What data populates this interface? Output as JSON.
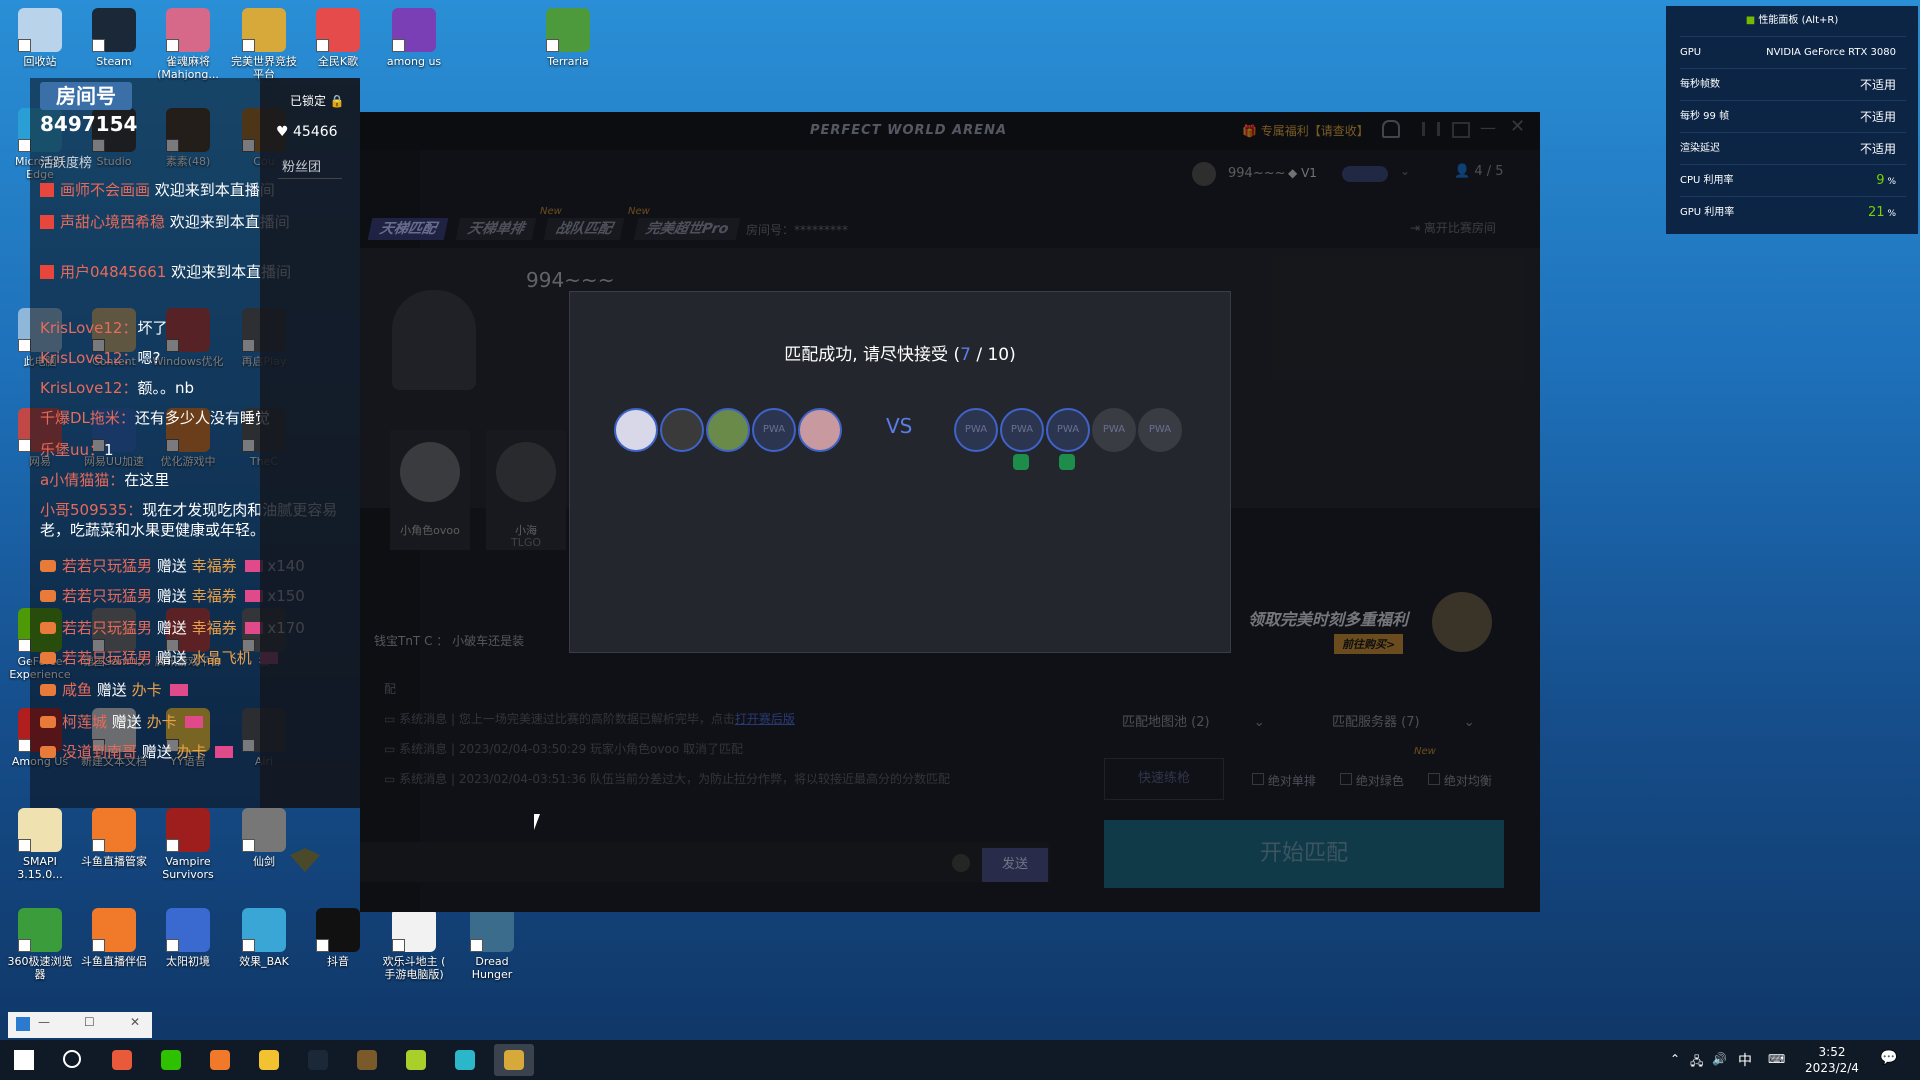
{
  "desktop_icons": [
    {
      "label": "回收站",
      "color": "#b9d3ea"
    },
    {
      "label": "Steam",
      "color": "#1b2838"
    },
    {
      "label": "雀魂麻将(Mahjong...",
      "color": "#d6698a"
    },
    {
      "label": "完美世界竞技平台",
      "color": "#d7a93a"
    },
    {
      "label": "全民K歌",
      "color": "#e64b4b"
    },
    {
      "label": "among us",
      "color": "#7a3fb5"
    },
    {
      "label": "Terraria",
      "color": "#4c9a3c"
    },
    {
      "label": "Microsoft Edge",
      "color": "#2a9fd6"
    },
    {
      "label": "Studio",
      "color": "#323232"
    },
    {
      "label": "素素(48)",
      "color": "#443322"
    },
    {
      "label": "Cou",
      "color": "#a0691e"
    },
    {
      "label": "此电脑",
      "color": "#8fb7da"
    },
    {
      "label": "Content",
      "color": "#c7b07a"
    },
    {
      "label": "Windows优化",
      "color": "#b73c3c"
    },
    {
      "label": "再启Play",
      "color": "#5a5a5a"
    },
    {
      "label": "网易",
      "color": "#c24747"
    },
    {
      "label": "网易UU加速",
      "color": "#2c6cc9"
    },
    {
      "label": "优化游戏中",
      "color": "#e07b27"
    },
    {
      "label": "TheC",
      "color": "#555555"
    },
    {
      "label": "GeForce Experience",
      "color": "#4e9a06"
    },
    {
      "label": "德国Sam\"以",
      "color": "#777777"
    },
    {
      "label": "腾讯游戏平台",
      "color": "#c23b3b"
    },
    {
      "label": "被",
      "color": "#666666"
    },
    {
      "label": "Among Us",
      "color": "#b11e1e"
    },
    {
      "label": "新建文本文档",
      "color": "#e0e0e0"
    },
    {
      "label": "YY语音",
      "color": "#ffd03a"
    },
    {
      "label": "Airi",
      "color": "#555555"
    },
    {
      "label": "SMAPI 3.15.0...",
      "color": "#f0e2b0"
    },
    {
      "label": "斗鱼直播管家",
      "color": "#f07a2a"
    },
    {
      "label": "Vampire Survivors",
      "color": "#9e1d1d"
    },
    {
      "label": "仙剑",
      "color": "#777777"
    },
    {
      "label": "360极速浏览器",
      "color": "#3a9c3a"
    },
    {
      "label": "斗鱼直播伴侣",
      "color": "#f07a2a"
    },
    {
      "label": "太阳初境",
      "color": "#3a6ad0"
    },
    {
      "label": "效果_BAK",
      "color": "#3aa6d6"
    },
    {
      "label": "抖音",
      "color": "#111111"
    },
    {
      "label": "欢乐斗地主 ( 手游电脑版)",
      "color": "#f2f2f2"
    },
    {
      "label": "Dread Hunger",
      "color": "#3c6c8c"
    }
  ],
  "stream": {
    "room_label": "房间号",
    "room_number": "8497154",
    "heat": "45466",
    "fans_label": "粉丝团",
    "locked_label": "已锁定",
    "rank_label": "活跃度榜",
    "chat": [
      {
        "user": "画师不会画画",
        "text": "欢迎来到本直播间"
      },
      {
        "user": "声甜心境西希稳",
        "text": "欢迎来到本直播间"
      },
      {
        "user": "用户04845661",
        "text": "欢迎来到本直播间"
      },
      {
        "user": "KrisLove12",
        "text": "坏了"
      },
      {
        "user": "KrisLove12",
        "text": "嗯?"
      },
      {
        "user": "KrisLove12",
        "text": "额。。nb"
      },
      {
        "user": "千爆DL拖米",
        "text": "还有多少人没有睡觉"
      },
      {
        "user": "乐堡uu",
        "text": "1"
      },
      {
        "user": "a小倩猫猫",
        "text": "在这里"
      },
      {
        "user": "小哥509535",
        "text": "现在才发现吃肉和油腻更容易老，吃蔬菜和水果更健康或年轻。"
      }
    ],
    "gifts": [
      {
        "user": "若若只玩猛男",
        "text": "赠送",
        "gift": "幸福券",
        "count": "x140"
      },
      {
        "user": "若若只玩猛男",
        "text": "赠送",
        "gift": "幸福券",
        "count": "x150"
      },
      {
        "user": "若若只玩猛男",
        "text": "赠送",
        "gift": "幸福券",
        "count": "x170"
      },
      {
        "user": "若若只玩猛男",
        "text": "赠送",
        "gift": "水晶飞机",
        "count": ""
      },
      {
        "user": "咸鱼",
        "text": "赠送",
        "gift": "办卡",
        "count": ""
      },
      {
        "user": "柯莲城",
        "text": "赠送",
        "gift": "办卡",
        "count": ""
      },
      {
        "user": "没道到南哥",
        "text": "赠送",
        "gift": "办卡",
        "count": ""
      }
    ]
  },
  "game": {
    "title": "PERFECT WORLD ARENA",
    "promo_link": "专属福利【请查收】",
    "player_count": "4 / 5",
    "user_name": "994~~~",
    "vip_label": "V1",
    "tabs": [
      "天梯匹配",
      "天梯单排",
      "战队匹配",
      "完美超世Pro"
    ],
    "new_badge": "New",
    "room_id_label": "房间号：*********",
    "leave_room": "离开比赛房间",
    "lobby_player": "994~~~",
    "teammate_name": "小角色ovoo",
    "teammate2_name": "小海",
    "teammate2_tag": "TLGO",
    "chat_line": "钱宝TnT  C  ：  小破车还是装",
    "pool_label": "配",
    "system_msgs": [
      {
        "text": "系统消息 | 您上一场完美速过比赛的高阶数据已解析完毕，点击",
        "link": "打开赛后版"
      },
      {
        "text": "系统消息 | 2023/02/04-03:50:29 玩家小角色ovoo 取消了匹配",
        "link": ""
      },
      {
        "text": "系统消息 | 2023/02/04-03:51:36 队伍当前分差过大，为防止拉分作弊，将以较接近最高分的分数匹配",
        "link": ""
      }
    ],
    "send_button": "发送",
    "promo_banner": "领取完美时刻多重福利",
    "promo_buy": "前往购买>",
    "map_pool": "匹配地图池 (2)",
    "server": "匹配服务器 (7)",
    "quick_match": "快速练枪",
    "opt_single": "绝对单排",
    "opt_green": "绝对绿色",
    "opt_balance": "绝对均衡",
    "start_button": "开始匹配",
    "modal": {
      "title_prefix": "匹配成功, 请尽快接受 (",
      "accepted": "7",
      "title_suffix": " / 10)",
      "vs": "VS",
      "placeholder": "PWA"
    }
  },
  "perf": {
    "title": "性能面板 (Alt+R)",
    "rows": [
      {
        "label": "GPU",
        "value": "NVIDIA GeForce RTX 3080",
        "unit": ""
      },
      {
        "label": "每秒帧数",
        "value": "不适用",
        "unit": ""
      },
      {
        "label": "每秒 99 帧",
        "value": "不适用",
        "unit": ""
      },
      {
        "label": "渲染延迟",
        "value": "不适用",
        "unit": ""
      },
      {
        "label": "CPU 利用率",
        "value": "9",
        "unit": "%"
      },
      {
        "label": "GPU 利用率",
        "value": "21",
        "unit": "%"
      }
    ]
  },
  "taskbar": {
    "time": "3:52",
    "date": "2023/2/4",
    "ime": "中",
    "apps": [
      {
        "name": "start",
        "color": "#ffffff"
      },
      {
        "name": "search",
        "color": "#ffffff"
      },
      {
        "name": "360-browser",
        "color": "#e85a3a"
      },
      {
        "name": "wechat",
        "color": "#2dc100"
      },
      {
        "name": "douyu",
        "color": "#f07a2a"
      },
      {
        "name": "yy",
        "color": "#f2c230"
      },
      {
        "name": "steam",
        "color": "#1b2838"
      },
      {
        "name": "csgo-helper",
        "color": "#7a5a2a"
      },
      {
        "name": "app-green",
        "color": "#a8d02a"
      },
      {
        "name": "uu-booster",
        "color": "#2bb7c9"
      },
      {
        "name": "perfect-world",
        "color": "#d7a93a"
      }
    ]
  }
}
